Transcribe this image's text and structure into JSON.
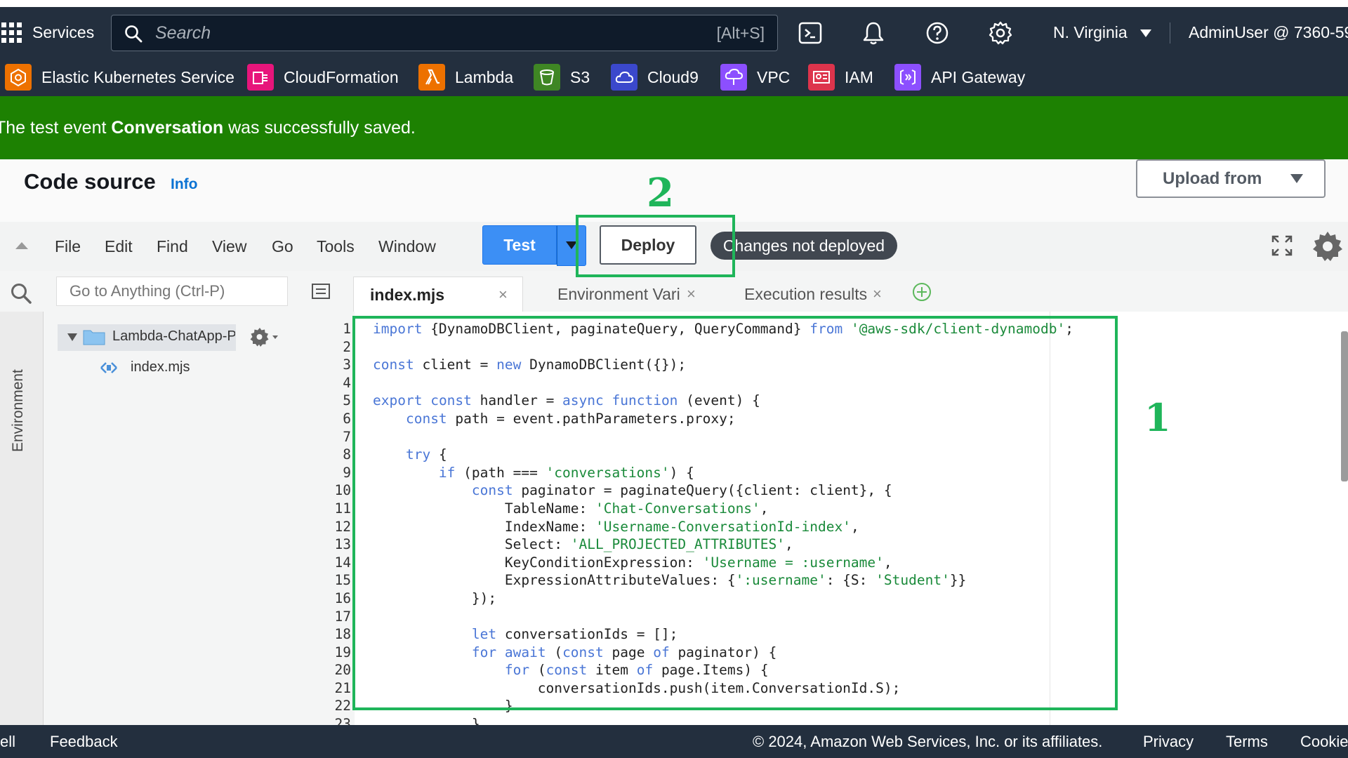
{
  "topnav": {
    "services_label": "Services",
    "search_placeholder": "Search",
    "search_shortcut": "[Alt+S]",
    "region": "N. Virginia",
    "account": "AdminUser @ 7360-59"
  },
  "favorites": [
    {
      "label": "Elastic Kubernetes Service",
      "icon": "eks-icon",
      "color": "#ed7100"
    },
    {
      "label": "CloudFormation",
      "icon": "cloudformation-icon",
      "color": "#e7157b"
    },
    {
      "label": "Lambda",
      "icon": "lambda-icon",
      "color": "#ed7100"
    },
    {
      "label": "S3",
      "icon": "s3-icon",
      "color": "#3f8624"
    },
    {
      "label": "Cloud9",
      "icon": "cloud9-icon",
      "color": "#3b48cc"
    },
    {
      "label": "VPC",
      "icon": "vpc-icon",
      "color": "#8c4fff"
    },
    {
      "label": "IAM",
      "icon": "iam-icon",
      "color": "#dd344c"
    },
    {
      "label": "API Gateway",
      "icon": "api-gateway-icon",
      "color": "#8c4fff"
    }
  ],
  "banner": {
    "prefix": "The test event ",
    "event_name": "Conversation",
    "suffix": " was successfully saved.",
    "color": "#1d8102"
  },
  "header": {
    "title": "Code source",
    "info": "Info",
    "upload_label": "Upload from"
  },
  "toolbar": {
    "menu": [
      "File",
      "Edit",
      "Find",
      "View",
      "Go",
      "Tools",
      "Window"
    ],
    "test_label": "Test",
    "deploy_label": "Deploy",
    "status": "Changes not deployed"
  },
  "sidebar": {
    "goto_placeholder": "Go to Anything (Ctrl-P)",
    "rail_label": "Environment",
    "folder_label": "Lambda-ChatApp-Pr",
    "file_label": "index.mjs"
  },
  "tabs": [
    {
      "label": "index.mjs",
      "active": true
    },
    {
      "label": "Environment Vari",
      "active": false
    },
    {
      "label": "Execution results",
      "active": false
    }
  ],
  "annotations": {
    "code_marker": "1",
    "deploy_marker": "2",
    "color": "#1fb55a"
  },
  "code_lines": [
    "import {DynamoDBClient, paginateQuery, QueryCommand} from '@aws-sdk/client-dynamodb';",
    "",
    "const client = new DynamoDBClient({});",
    "",
    "export const handler = async function (event) {",
    "    const path = event.pathParameters.proxy;",
    "",
    "    try {",
    "        if (path === 'conversations') {",
    "            const paginator = paginateQuery({client: client}, {",
    "                TableName: 'Chat-Conversations',",
    "                IndexName: 'Username-ConversationId-index',",
    "                Select: 'ALL_PROJECTED_ATTRIBUTES',",
    "                KeyConditionExpression: 'Username = :username',",
    "                ExpressionAttributeValues: {':username': {S: 'Student'}}",
    "            });",
    "",
    "            let conversationIds = [];",
    "            for await (const page of paginator) {",
    "                for (const item of page.Items) {",
    "                    conversationIds.push(item.ConversationId.S);",
    "                }",
    "            }"
  ],
  "footer": {
    "cloudshell": "ell",
    "feedback": "Feedback",
    "copyright": "© 2024, Amazon Web Services, Inc. or its affiliates.",
    "privacy": "Privacy",
    "terms": "Terms",
    "cookies": "Cookie"
  }
}
